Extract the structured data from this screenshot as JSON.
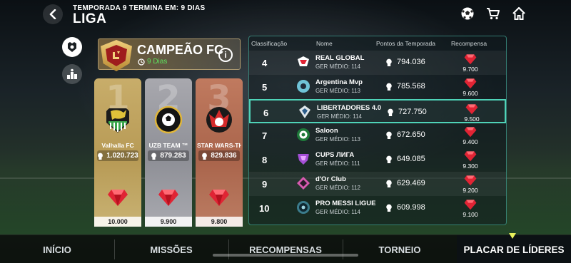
{
  "header": {
    "season_text": "TEMPORADA 9 TERMINA EM: 9 DIAS",
    "title": "LIGA",
    "back_icon": "back-arrow-icon",
    "icons": [
      "soccer-ball-icon",
      "cart-icon",
      "home-icon"
    ]
  },
  "side_tabs": [
    {
      "icon": "club-crest-icon",
      "active": true
    },
    {
      "icon": "podium-icon",
      "active": false
    }
  ],
  "champion": {
    "title": "CAMPEÃO FC",
    "days": "9 Dias",
    "info_label": "i"
  },
  "podium": [
    {
      "place": "1",
      "name": "Valhalla FC",
      "points": "1.020.723",
      "reward": "10.000"
    },
    {
      "place": "2",
      "name": "UZB TEAM ™",
      "points": "879.283",
      "reward": "9.900"
    },
    {
      "place": "3",
      "name": "STAR WARS-TH",
      "points": "829.836",
      "reward": "9.800"
    }
  ],
  "table": {
    "headers": {
      "rank": "Classificação",
      "name": "Nome",
      "points": "Pontos da Temporada",
      "reward": "Recompensa"
    },
    "rows": [
      {
        "rank": "4",
        "name": "REAL GLOBAL",
        "ger": "GER MÉDIO: 114",
        "points": "794.036",
        "reward": "9.700"
      },
      {
        "rank": "5",
        "name": "Argentina Mvp",
        "ger": "GER MÉDIO: 113",
        "points": "785.568",
        "reward": "9.600"
      },
      {
        "rank": "6",
        "name": "LIBERTADORES 4.0",
        "ger": "GER MÉDIO: 114",
        "points": "727.750",
        "reward": "9.500"
      },
      {
        "rank": "7",
        "name": "Saloon",
        "ger": "GER MÉDIO: 113",
        "points": "672.650",
        "reward": "9.400"
      },
      {
        "rank": "8",
        "name": "CUPS ЛИГА",
        "ger": "GER MÉDIO: 111",
        "points": "649.085",
        "reward": "9.300"
      },
      {
        "rank": "9",
        "name": "d'Or Club",
        "ger": "GER MÉDIO: 112",
        "points": "629.469",
        "reward": "9.200"
      },
      {
        "rank": "10",
        "name": "PRO MESSI LIGUE",
        "ger": "GER MÉDIO: 114",
        "points": "609.998",
        "reward": "9.100"
      }
    ],
    "highlight_rank": "6"
  },
  "nav": {
    "items": [
      "INÍCIO",
      "MISSÕES",
      "RECOMPENSAS",
      "TORNEIO",
      "PLACAR DE LÍDERES"
    ],
    "active": "PLACAR DE LÍDERES"
  },
  "colors": {
    "accent_teal": "#4fd3b8",
    "gem_red": "#e02434",
    "days_green": "#5ee05e",
    "gold": "#c8ad6a",
    "silver": "#a8a8ae",
    "bronze": "#c07a5f"
  }
}
